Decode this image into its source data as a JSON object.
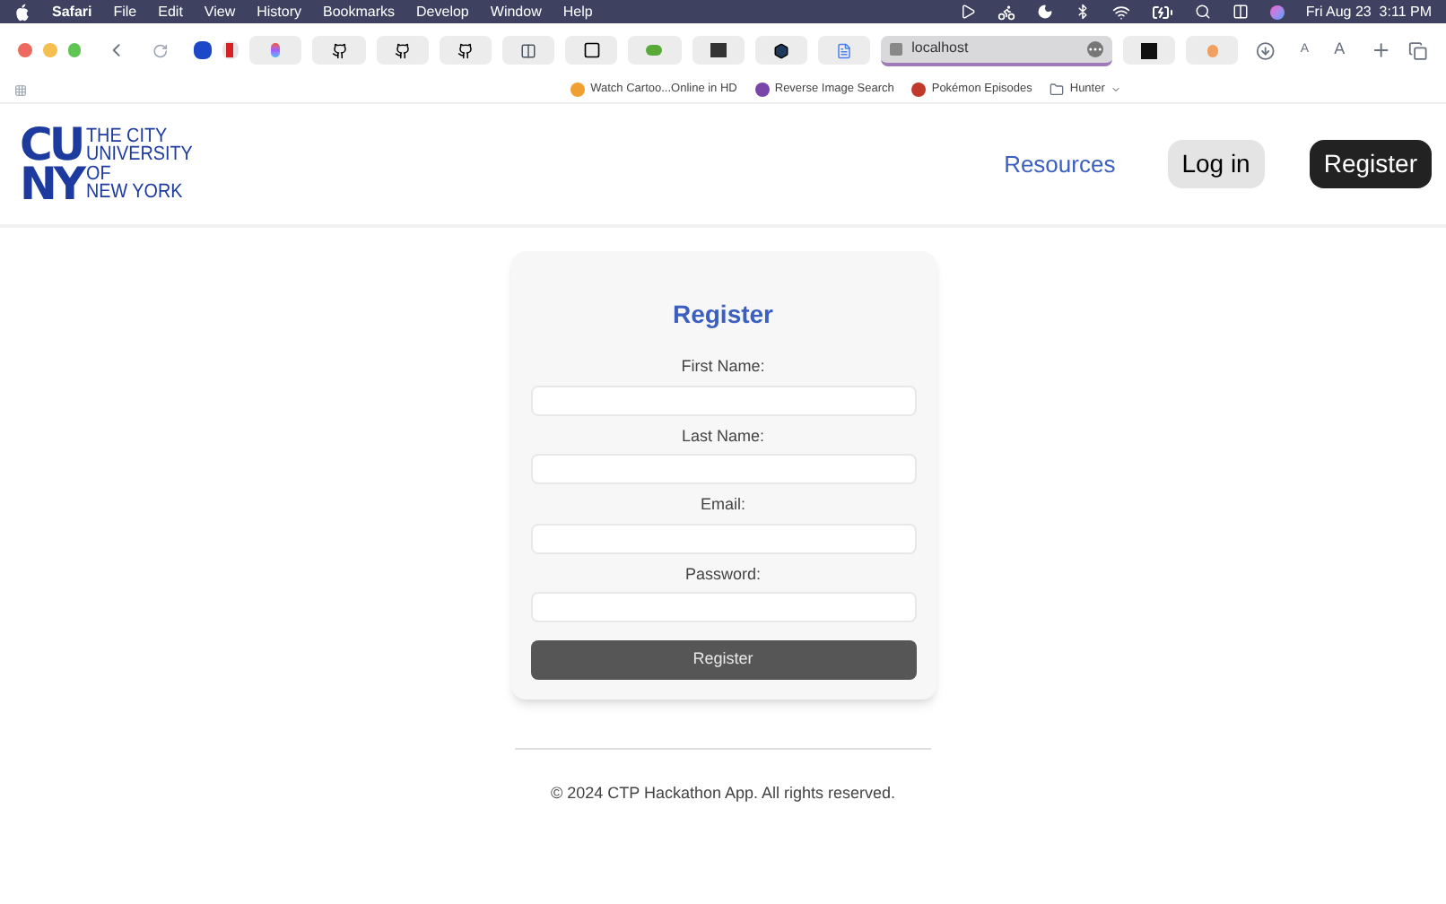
{
  "menu_bar": {
    "app": "Safari",
    "items": [
      "File",
      "Edit",
      "View",
      "History",
      "Bookmarks",
      "Develop",
      "Window",
      "Help"
    ],
    "clock": "Fri Aug 23  3:11 PM"
  },
  "toolbar": {
    "address": "localhost",
    "text_size_small": "A",
    "text_size_large": "A"
  },
  "bookmarks": [
    {
      "label": "Watch Cartoo...Online in HD",
      "kind": "site"
    },
    {
      "label": "Reverse Image Search",
      "kind": "site"
    },
    {
      "label": "Pokémon Episodes",
      "kind": "site"
    },
    {
      "label": "Hunter",
      "kind": "folder"
    }
  ],
  "header": {
    "logo_mark": [
      "CU",
      "NY"
    ],
    "logo_text": [
      "THE CITY",
      "UNIVERSITY",
      "OF",
      "NEW YORK"
    ],
    "nav": [
      {
        "label": "Resources",
        "kind": "link"
      },
      {
        "label": "Log in",
        "kind": "light"
      },
      {
        "label": "Register",
        "kind": "dark"
      }
    ]
  },
  "form": {
    "title": "Register",
    "fields": [
      {
        "label": "First Name:"
      },
      {
        "label": "Last Name:"
      },
      {
        "label": "Email:"
      },
      {
        "label": "Password:"
      }
    ],
    "submit": "Register"
  },
  "footer": {
    "text": "© 2024 CTP Hackathon App. All rights reserved."
  }
}
